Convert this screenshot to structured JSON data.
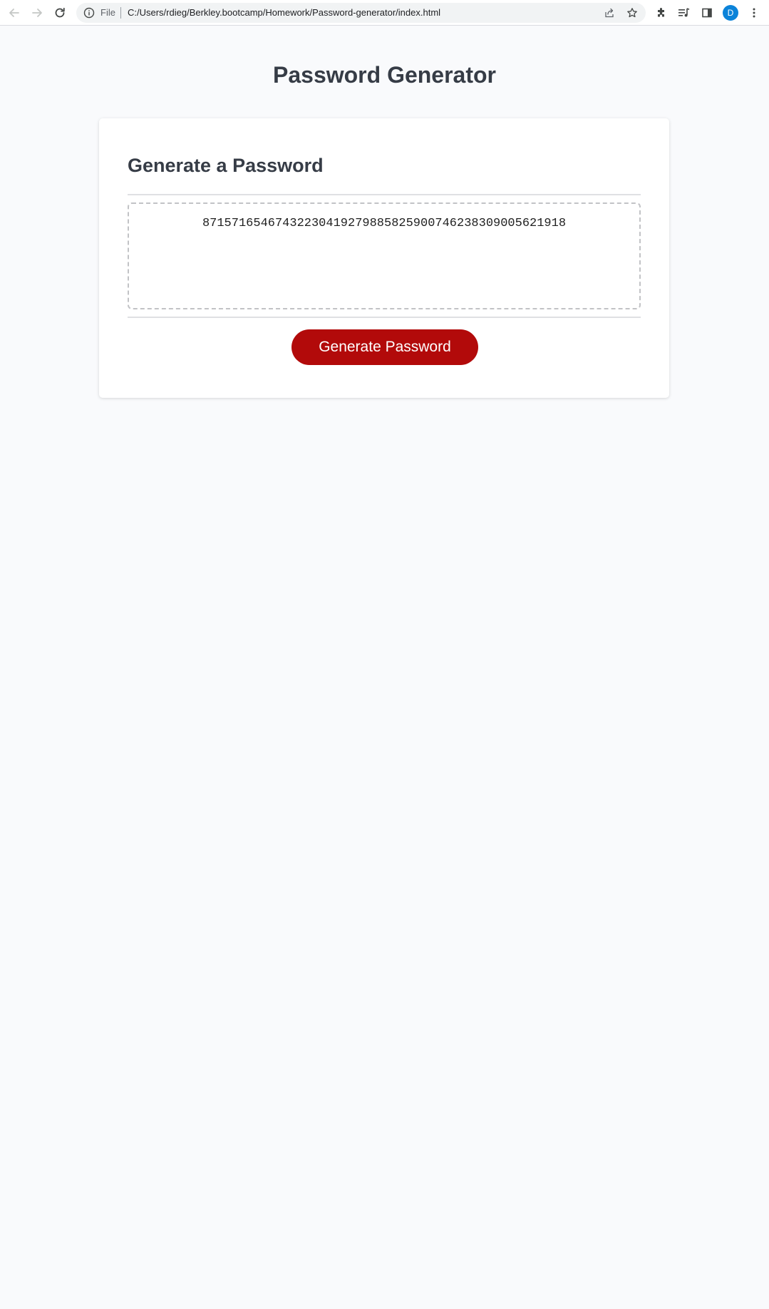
{
  "browser": {
    "scheme_label": "File",
    "url": "C:/Users/rdieg/Berkley.bootcamp/Homework/Password-generator/index.html",
    "profile_initial": "D",
    "icons": {
      "back": "arrow-left-icon",
      "forward": "arrow-right-icon",
      "reload": "reload-icon",
      "site_info": "info-icon",
      "share": "share-icon",
      "bookmark": "star-icon",
      "extensions": "puzzle-icon",
      "media": "media-queue-icon",
      "side_panel": "side-panel-icon",
      "menu": "kebab-menu-icon"
    },
    "profile_color": "#0b83d9"
  },
  "page": {
    "title": "Password Generator",
    "card": {
      "header": "Generate a Password",
      "password_value": "87157165467432230419279885825900746238309005621918",
      "button_label": "Generate Password"
    }
  },
  "colors": {
    "background": "#f9fafc",
    "text": "#363c46",
    "button": "#b20a0a",
    "button_text": "#ffffff"
  }
}
